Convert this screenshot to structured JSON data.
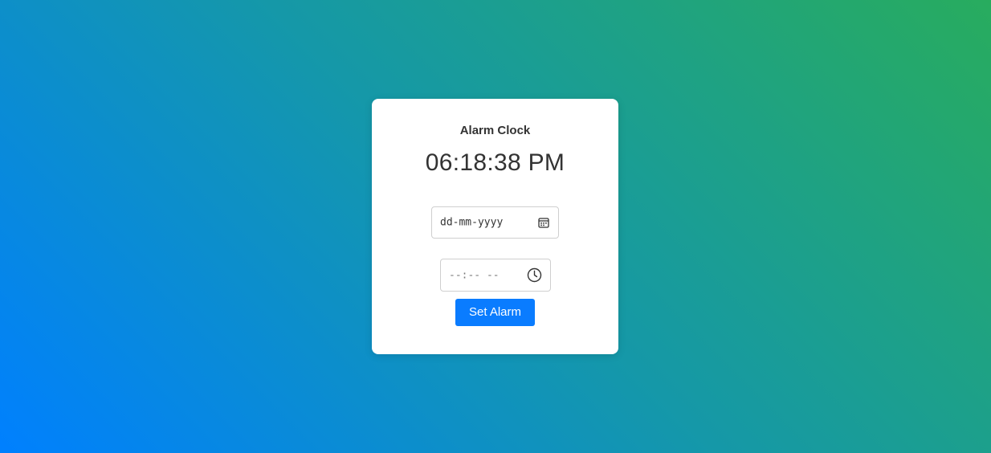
{
  "card": {
    "title": "Alarm Clock",
    "current_time": "06:18:38 PM"
  },
  "date_input": {
    "placeholder": "dd-mm-yyyy",
    "icon": "calendar-icon"
  },
  "time_input": {
    "placeholder": "--:-- --",
    "icon": "clock-icon"
  },
  "set_button": {
    "label": "Set Alarm",
    "color": "#0a7cff"
  },
  "colors": {
    "background_start": "#0080ff",
    "background_end": "#28ac5e",
    "card": "#ffffff"
  }
}
